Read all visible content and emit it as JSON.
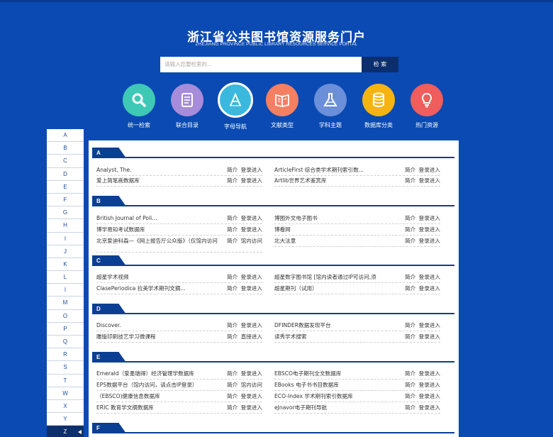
{
  "header": {
    "title_cn": "浙江省公共图书馆资源服务门户",
    "title_en": "ZHEJIANG PROVINCE PUBLIC LIBRARY RESOURCES SERVICE PORTAL"
  },
  "search": {
    "placeholder": "请输入您要检索的...",
    "button_label": "检 索"
  },
  "categories": [
    {
      "label": "统一检索",
      "icon": "search-icon",
      "color": "#3ec9b6"
    },
    {
      "label": "联合目录",
      "icon": "document-icon",
      "color": "#a78cd9"
    },
    {
      "label": "字母导航",
      "icon": "letter-a-icon",
      "color": "#3ab8de"
    },
    {
      "label": "文献类型",
      "icon": "book-icon",
      "color": "#f47f61"
    },
    {
      "label": "学科主题",
      "icon": "flask-icon",
      "color": "#6b8fd8"
    },
    {
      "label": "数据库分类",
      "icon": "database-icon",
      "color": "#f6b413"
    },
    {
      "label": "热门资源",
      "icon": "bulb-icon",
      "color": "#ef5d5d"
    }
  ],
  "alphabet": [
    "A",
    "B",
    "C",
    "D",
    "E",
    "F",
    "G",
    "H",
    "I",
    "J",
    "K",
    "L",
    "I",
    "M",
    "O",
    "P",
    "Q",
    "R",
    "S",
    "T",
    "W",
    "X",
    "Y",
    "Z"
  ],
  "active_letter": "Z",
  "link_intro": "简介",
  "sections": [
    {
      "letter": "A",
      "items": [
        {
          "name": "Analyst, The.",
          "action": "登录进入"
        },
        {
          "name": "ArticleFirst 综合类学术期刊索引数...",
          "action": "登录进入"
        },
        {
          "name": "爱上简笔画数据库",
          "action": "登录进入"
        },
        {
          "name": "Artlib世界艺术鉴赏库",
          "action": "登录进入"
        }
      ]
    },
    {
      "letter": "B",
      "items": [
        {
          "name": "British Journal of Poli...",
          "action": "登录进入"
        },
        {
          "name": "博图外文电子图书",
          "action": "登录进入"
        },
        {
          "name": "博学易知考试数据库",
          "action": "登录进入"
        },
        {
          "name": "博看网",
          "action": "登录进入"
        },
        {
          "name": "北京爱迪科森—《网上报告厅公众版》（仅馆内访问",
          "action": "馆内访问"
        },
        {
          "name": "北大法意",
          "action": "登录进入"
        }
      ]
    },
    {
      "letter": "C",
      "items": [
        {
          "name": "超星学术视频",
          "action": "登录进入"
        },
        {
          "name": "超星数字图书馆 [馆内读者通过IP可访问,须",
          "action": "登录进入"
        },
        {
          "name": "ClasePeriodica 拉美学术期刊文摘...",
          "action": "登录进入"
        },
        {
          "name": "超星期刊（试用）",
          "action": "登录进入"
        }
      ]
    },
    {
      "letter": "D",
      "items": [
        {
          "name": "Discover.",
          "action": "登录进入"
        },
        {
          "name": "DFINDER数据发现平台",
          "action": "登录进入"
        },
        {
          "name": "雕版印刷技艺学习微课程",
          "action": "直接进入"
        },
        {
          "name": "读秀学术搜索",
          "action": "登录进入"
        }
      ]
    },
    {
      "letter": "E",
      "items": [
        {
          "name": "Emerald（爱墨瑞得）经济管理学数据库",
          "action": "登录进入"
        },
        {
          "name": "EBSCO电子期刊全文数据库",
          "action": "登录进入"
        },
        {
          "name": "EPS数据平台（馆内访问，请点击IP登录）",
          "action": "馆内访问"
        },
        {
          "name": "EBooks 电子书书目数据库",
          "action": "登录进入"
        },
        {
          "name": "（EBSCO)健康信息数据库",
          "action": "登录进入"
        },
        {
          "name": "ECO-Index 学术期刊索引数据库",
          "action": "登录进入"
        },
        {
          "name": "ERIC 教育学文摘数据库",
          "action": "登录进入"
        },
        {
          "name": "eJnavor电子期刊导航",
          "action": "登录进入"
        }
      ]
    },
    {
      "letter": "F",
      "items": []
    }
  ]
}
